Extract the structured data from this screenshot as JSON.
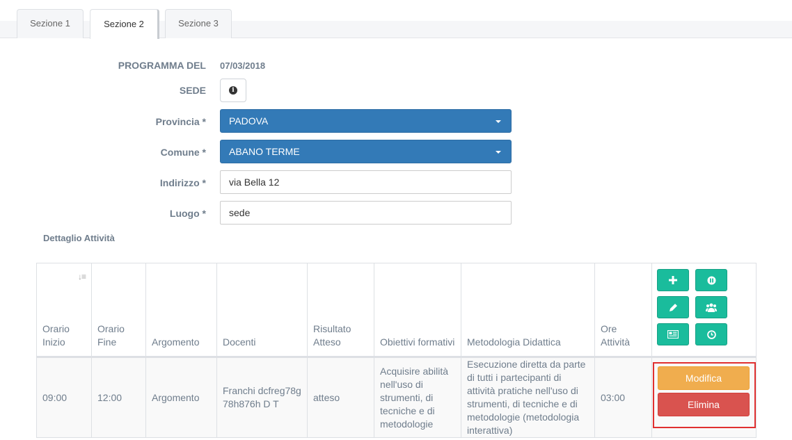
{
  "tabs": [
    {
      "label": "Sezione 1"
    },
    {
      "label": "Sezione 2",
      "active": true
    },
    {
      "label": "Sezione 3"
    }
  ],
  "form": {
    "programma_label": "PROGRAMMA DEL",
    "programma_value": "07/03/2018",
    "sede_label": "SEDE",
    "provincia_label": "Provincia *",
    "provincia_value": "PADOVA",
    "comune_label": "Comune *",
    "comune_value": "ABANO TERME",
    "indirizzo_label": "Indirizzo *",
    "indirizzo_value": "via Bella 12",
    "luogo_label": "Luogo *",
    "luogo_value": "sede"
  },
  "section_title": "Dettaglio Attività",
  "table": {
    "headers": {
      "orario_inizio": "Orario Inizio",
      "orario_fine": "Orario Fine",
      "argomento": "Argomento",
      "docenti": "Docenti",
      "risultato": "Risultato Atteso",
      "obiettivi": "Obiettivi formativi",
      "metodologia": "Metodologia Didattica",
      "ore": "Ore Attività"
    },
    "row": {
      "orario_inizio": "09:00",
      "orario_fine": "12:00",
      "argomento": "Argomento",
      "docenti": "Franchi dcfreg78g78h876h D T",
      "risultato": "atteso",
      "obiettivi": "Acquisire abilità nell'uso di strumenti, di tecniche e di metodologie",
      "metodologia": "Esecuzione diretta da parte di tutti i partecipanti di attività pratiche nell'uso di strumenti, di tecniche e di metodologie (metodologia interattiva)",
      "ore": "03:00"
    },
    "buttons": {
      "modifica": "Modifica",
      "elimina": "Elimina"
    }
  },
  "colors": {
    "primary": "#337ab7",
    "success": "#1abc9c",
    "warning": "#f0ad4e",
    "danger": "#d9534f",
    "highlight": "#e03030"
  }
}
